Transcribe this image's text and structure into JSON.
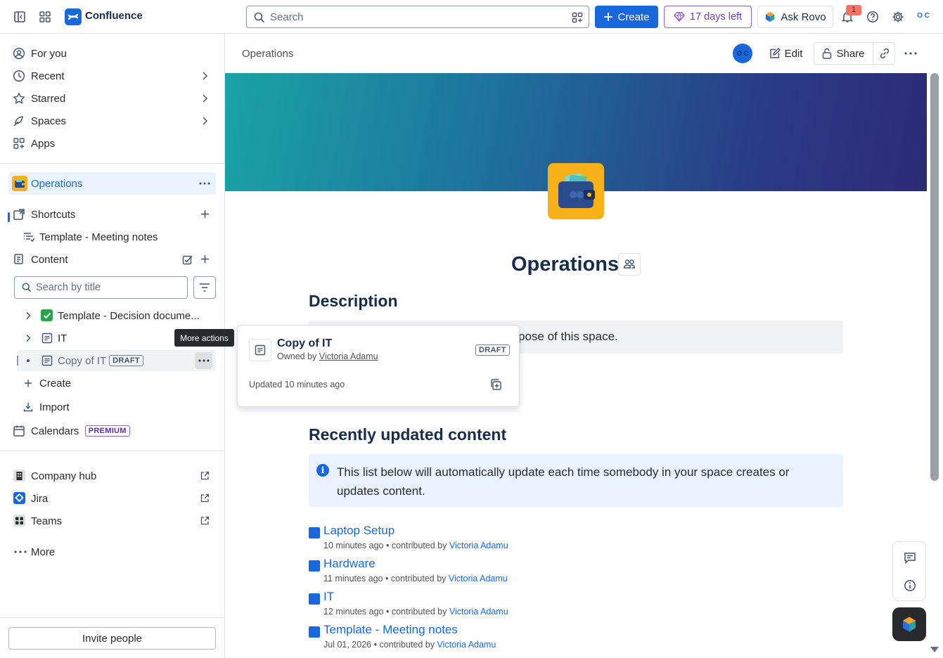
{
  "topbar": {
    "app_name": "Confluence",
    "search_placeholder": "Search",
    "create_label": "Create",
    "trial_label": "17 days left",
    "ask_rovo_label": "Ask Rovo",
    "notification_count": "1",
    "avatar_initials": "O C"
  },
  "sidebar": {
    "nav": [
      {
        "label": "For you"
      },
      {
        "label": "Recent"
      },
      {
        "label": "Starred"
      },
      {
        "label": "Spaces"
      },
      {
        "label": "Apps"
      }
    ],
    "space_name": "Operations",
    "shortcuts_label": "Shortcuts",
    "shortcut_item": "Template - Meeting notes",
    "content_label": "Content",
    "search_placeholder": "Search by title",
    "tree": [
      {
        "label": "Template - Decision docume..."
      },
      {
        "label": "IT"
      },
      {
        "label": "Copy of IT",
        "badge": "DRAFT"
      }
    ],
    "tooltip": "More actions",
    "create_label": "Create",
    "import_label": "Import",
    "calendars_label": "Calendars",
    "calendars_badge": "PREMIUM",
    "apps": [
      {
        "label": "Company hub"
      },
      {
        "label": "Jira"
      },
      {
        "label": "Teams"
      }
    ],
    "more_label": "More",
    "invite_label": "Invite people"
  },
  "header": {
    "breadcrumb": "Operations",
    "edit_label": "Edit",
    "share_label": "Share",
    "avatar_initials": "O C"
  },
  "page": {
    "title": "Operations",
    "description_heading": "Description",
    "description_text": "pose of this space.",
    "recent_heading": "Recently updated content",
    "info_text": "This list below will automatically update each time somebody in your space creates or updates content.",
    "recent_items": [
      {
        "title": "Laptop Setup",
        "time": "10 minutes ago",
        "contrib": "contributed by",
        "author": "Victoria Adamu"
      },
      {
        "title": "Hardware",
        "time": "11 minutes ago",
        "contrib": "contributed by",
        "author": "Victoria Adamu"
      },
      {
        "title": "IT",
        "time": "12 minutes ago",
        "contrib": "contributed by",
        "author": "Victoria Adamu"
      },
      {
        "title": "Template - Meeting notes",
        "time": "Jul 01, 2026",
        "contrib": "contributed by",
        "author": "Victoria Adamu"
      }
    ]
  },
  "hovercard": {
    "title": "Copy of IT",
    "owned_by": "Owned by",
    "owner": "Victoria Adamu",
    "badge": "DRAFT",
    "updated": "Updated 10 minutes ago"
  },
  "colors": {
    "brand": "#1868db",
    "trial_purple": "#6e3ec6",
    "space_icon_bg": "#f7b018"
  }
}
